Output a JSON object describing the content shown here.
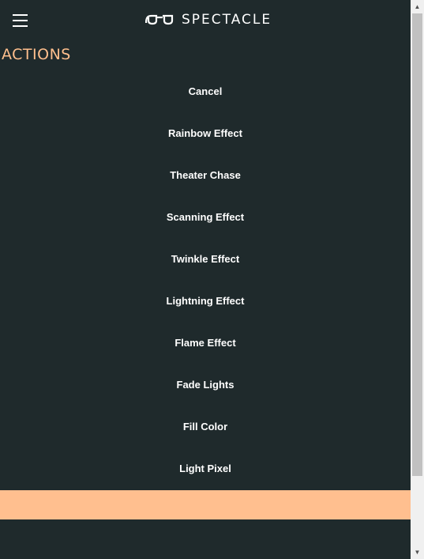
{
  "header": {
    "brand_name": "SPECTACLE",
    "menu_icon": "hamburger-menu-icon",
    "logo_icon": "spectacles-logo-icon"
  },
  "section": {
    "title": "ACTIONS"
  },
  "actions": [
    "Cancel",
    "Rainbow Effect",
    "Theater Chase",
    "Scanning Effect",
    "Twinkle Effect",
    "Lightning Effect",
    "Flame Effect",
    "Fade Lights",
    "Fill Color",
    "Light Pixel"
  ],
  "colors": {
    "background": "#1f2a2c",
    "accent": "#ffbf8f",
    "text": "#ffffff"
  },
  "scrollbar": {
    "up_icon": "scroll-up-arrow-icon",
    "down_icon": "scroll-down-arrow-icon"
  }
}
